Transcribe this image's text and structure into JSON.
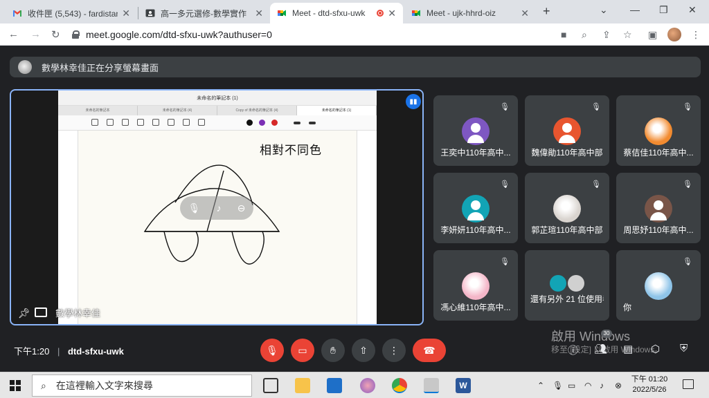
{
  "browser": {
    "tabs": [
      {
        "title": "收件匣 (5,543) - fardistan",
        "icon": "gmail-icon",
        "active": false
      },
      {
        "title": "高一多元選修-數學實作",
        "icon": "classroom-icon",
        "active": false
      },
      {
        "title": "Meet - dtd-sfxu-uwk",
        "icon": "meet-icon",
        "active": true
      },
      {
        "title": "Meet - ujk-hhrd-oiz",
        "icon": "meet-icon",
        "active": false
      }
    ],
    "close_glyph": "✕",
    "new_tab_glyph": "+",
    "url": "meet.google.com/dtd-sfxu-uwk?authuser=0"
  },
  "meet": {
    "banner_text": "數學林幸佳正在分享螢幕畫面",
    "presenter": {
      "name": "數學林幸佳",
      "ipad_title": "未命名的筆記本 (1)",
      "ipad_tabs": [
        "未命名的筆記本",
        "未命名的筆記本 (4)",
        "Copy of 未命名的筆記本 (4)",
        "未命名的筆記本 (1)"
      ],
      "handwriting": "相對不同色"
    },
    "participants": [
      {
        "name": "王奕中110年高中...",
        "avatar_color": "#7e57c2",
        "type": "person"
      },
      {
        "name": "魏偉勛110年高中部",
        "avatar_color": "#e8552f",
        "type": "person"
      },
      {
        "name": "蔡佶佳110年高中...",
        "avatar_color": "#f28b30",
        "type": "photo"
      },
      {
        "name": "李妍妍110年高中...",
        "avatar_color": "#12a4b5",
        "type": "person"
      },
      {
        "name": "郭芷瑄110年高中部",
        "avatar_color": "#d9d4cf",
        "type": "photo"
      },
      {
        "name": "周思妤110年高中...",
        "avatar_color": "#795548",
        "type": "person"
      },
      {
        "name": "馮心維110年高中...",
        "avatar_color": "#f4b6c8",
        "type": "photo"
      },
      {
        "name": "還有另外 21 位使用者",
        "avatar_color": "#26a69a",
        "type": "group"
      },
      {
        "name": "你",
        "avatar_color": "#8ec4e8",
        "type": "photo"
      }
    ],
    "time": "下午1:20",
    "meeting_code": "dtd-sfxu-uwk",
    "people_count": "30"
  },
  "windows": {
    "activation_line1": "啟用 Windows",
    "activation_line2": "移至 [設定] 以啟用 Windows。",
    "search_placeholder": "在這裡輸入文字來搜尋",
    "clock_time": "下午 01:20",
    "clock_date": "2022/5/26"
  }
}
